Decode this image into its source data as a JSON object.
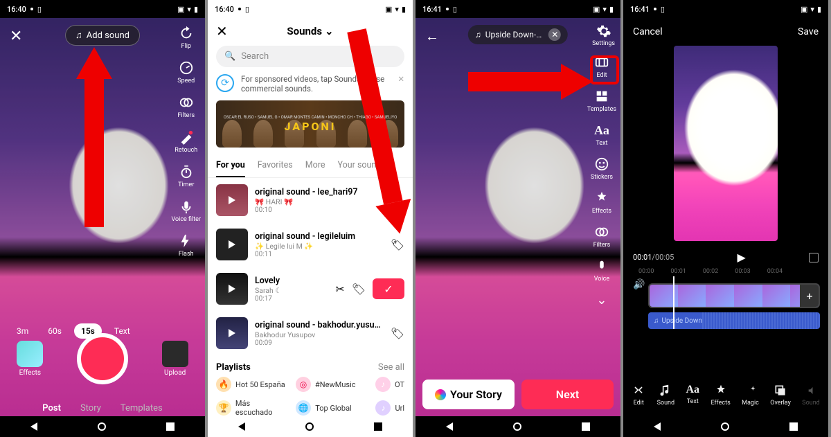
{
  "status": {
    "time1": "16:40",
    "time3": "16:41"
  },
  "s1": {
    "add_sound": "Add sound",
    "tools": {
      "flip": "Flip",
      "speed": "Speed",
      "filters": "Filters",
      "retouch": "Retouch",
      "timer": "Timer",
      "voicefilter": "Voice filter",
      "flash": "Flash"
    },
    "durations": {
      "d3m": "3m",
      "d60s": "60s",
      "d15s": "15s",
      "text": "Text"
    },
    "effects": "Effects",
    "upload": "Upload",
    "tabs": {
      "post": "Post",
      "story": "Story",
      "templates": "Templates"
    }
  },
  "s2": {
    "title": "Sounds",
    "search_placeholder": "Search",
    "sponsor_text": "For sponsored videos, tap Sounds to use commercial sounds.",
    "banner_title": "JAPONI",
    "banner_sub": "OSCAR EL RUSO • SAMUEL G • OMAR MONTES      CAMIN • MONCHO CH • THIAGO • SAMUELIYO",
    "tabs": {
      "foryou": "For you",
      "favorites": "Favorites",
      "more": "More",
      "yoursounds": "Your sounds"
    },
    "sounds": [
      {
        "title": "original sound - lee_hari97",
        "artist": "🎀 HARI 🎀",
        "dur": "00:10"
      },
      {
        "title": "original sound - legileluim",
        "artist": "✨ Legile lui M ✨",
        "dur": "00:11"
      },
      {
        "title": "Lovely",
        "artist": "Sarah ☾",
        "dur": "00:17"
      },
      {
        "title": "original sound - bakhodur.yusupov",
        "artist": "Bakhodur Yusupov",
        "dur": "00:09"
      }
    ],
    "playlists_title": "Playlists",
    "see_all": "See all",
    "playlists": [
      {
        "name": "Hot 50 España",
        "colorName": "fire"
      },
      {
        "name": "#NewMusic",
        "colorName": "newmusic"
      },
      {
        "name": "OT",
        "colorName": "ot"
      },
      {
        "name": "Más escuchado",
        "colorName": "trophy"
      },
      {
        "name": "Top Global",
        "colorName": "globe"
      },
      {
        "name": "Url",
        "colorName": "url"
      }
    ]
  },
  "s3": {
    "sound_name": "Upside Down-…",
    "settings": "Settings",
    "tools": {
      "edit": "Edit",
      "templates": "Templates",
      "text": "Text",
      "stickers": "Stickers",
      "effects": "Effects",
      "filters": "Filters",
      "voice": "Voice"
    },
    "your_story": "Your Story",
    "next": "Next"
  },
  "s4": {
    "cancel": "Cancel",
    "save": "Save",
    "time_current": "00:01",
    "time_total": "/00:05",
    "ruler": [
      "00:00",
      "00:01",
      "00:02",
      "00:03",
      "00:04"
    ],
    "sound_label": "Upside Down",
    "tools": {
      "edit": "Edit",
      "sound": "Sound",
      "text": "Text",
      "effects": "Effects",
      "magic": "Magic",
      "overlay": "Overlay",
      "sound2": "Sound"
    }
  }
}
